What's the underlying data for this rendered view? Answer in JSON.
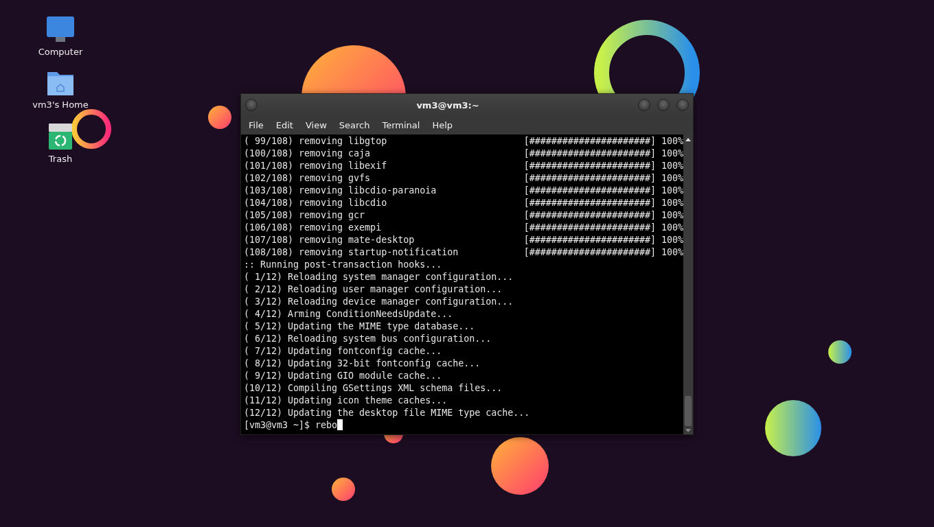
{
  "desktop_icons": [
    {
      "kind": "computer",
      "label": "Computer"
    },
    {
      "kind": "home",
      "label": "vm3's Home"
    },
    {
      "kind": "trash",
      "label": "Trash"
    }
  ],
  "window": {
    "title": "vm3@vm3:~"
  },
  "menu": [
    "File",
    "Edit",
    "View",
    "Search",
    "Terminal",
    "Help"
  ],
  "terminal": {
    "lines": [
      {
        "kind": "progress",
        "text": "( 99/108) removing libgtop",
        "bar": "[######################]",
        "percent": "100%"
      },
      {
        "kind": "progress",
        "text": "(100/108) removing caja",
        "bar": "[######################]",
        "percent": "100%"
      },
      {
        "kind": "progress",
        "text": "(101/108) removing libexif",
        "bar": "[######################]",
        "percent": "100%"
      },
      {
        "kind": "progress",
        "text": "(102/108) removing gvfs",
        "bar": "[######################]",
        "percent": "100%"
      },
      {
        "kind": "progress",
        "text": "(103/108) removing libcdio-paranoia",
        "bar": "[######################]",
        "percent": "100%"
      },
      {
        "kind": "progress",
        "text": "(104/108) removing libcdio",
        "bar": "[######################]",
        "percent": "100%"
      },
      {
        "kind": "progress",
        "text": "(105/108) removing gcr",
        "bar": "[######################]",
        "percent": "100%"
      },
      {
        "kind": "progress",
        "text": "(106/108) removing exempi",
        "bar": "[######################]",
        "percent": "100%"
      },
      {
        "kind": "progress",
        "text": "(107/108) removing mate-desktop",
        "bar": "[######################]",
        "percent": "100%"
      },
      {
        "kind": "progress",
        "text": "(108/108) removing startup-notification",
        "bar": "[######################]",
        "percent": "100%"
      },
      {
        "kind": "plain",
        "text": ":: Running post-transaction hooks..."
      },
      {
        "kind": "plain",
        "text": "( 1/12) Reloading system manager configuration..."
      },
      {
        "kind": "plain",
        "text": "( 2/12) Reloading user manager configuration..."
      },
      {
        "kind": "plain",
        "text": "( 3/12) Reloading device manager configuration..."
      },
      {
        "kind": "plain",
        "text": "( 4/12) Arming ConditionNeedsUpdate..."
      },
      {
        "kind": "plain",
        "text": "( 5/12) Updating the MIME type database..."
      },
      {
        "kind": "plain",
        "text": "( 6/12) Reloading system bus configuration..."
      },
      {
        "kind": "plain",
        "text": "( 7/12) Updating fontconfig cache..."
      },
      {
        "kind": "plain",
        "text": "( 8/12) Updating 32-bit fontconfig cache..."
      },
      {
        "kind": "plain",
        "text": "( 9/12) Updating GIO module cache..."
      },
      {
        "kind": "plain",
        "text": "(10/12) Compiling GSettings XML schema files..."
      },
      {
        "kind": "plain",
        "text": "(11/12) Updating icon theme caches..."
      },
      {
        "kind": "plain",
        "text": "(12/12) Updating the desktop file MIME type cache..."
      }
    ],
    "prompt": "[vm3@vm3 ~]$ rebo"
  }
}
